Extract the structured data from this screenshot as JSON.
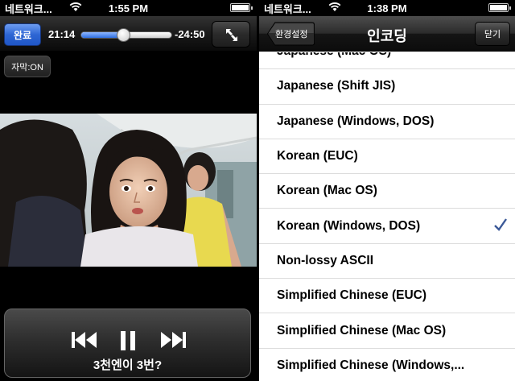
{
  "left": {
    "status": {
      "carrier": "네트워크...",
      "time": "1:55 PM"
    },
    "controls": {
      "done_label": "완료",
      "elapsed": "21:14",
      "remaining": "-24:50",
      "progress": 0.46,
      "subtitle_toggle": "자막:ON"
    },
    "subtitle": "3천엔이 3번?",
    "icons": [
      "wifi-icon",
      "battery-icon",
      "fullscreen-icon",
      "previous-icon",
      "pause-icon",
      "next-icon"
    ]
  },
  "right": {
    "status": {
      "carrier": "네트워크...",
      "time": "1:38 PM"
    },
    "nav": {
      "back_label": "환경설정",
      "title": "인코딩",
      "close_label": "닫기"
    },
    "encodings": [
      {
        "label": "Japanese (Mac OS)",
        "checked": false
      },
      {
        "label": "Japanese (Shift JIS)",
        "checked": false
      },
      {
        "label": "Japanese (Windows, DOS)",
        "checked": false
      },
      {
        "label": "Korean (EUC)",
        "checked": false
      },
      {
        "label": "Korean (Mac OS)",
        "checked": false
      },
      {
        "label": "Korean (Windows, DOS)",
        "checked": true
      },
      {
        "label": "Non-lossy ASCII",
        "checked": false
      },
      {
        "label": "Simplified Chinese (EUC)",
        "checked": false
      },
      {
        "label": "Simplified Chinese (Mac OS)",
        "checked": false
      },
      {
        "label": "Simplified Chinese (Windows,...",
        "checked": false
      }
    ],
    "check_color": "#3b5998"
  }
}
